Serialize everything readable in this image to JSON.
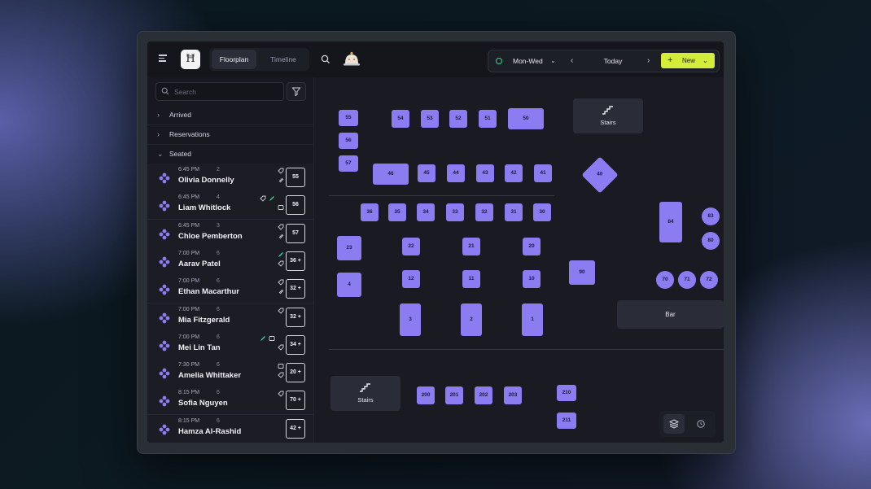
{
  "app": {
    "logo_text": "Ħ",
    "tabs": [
      "Floorplan",
      "Timeline"
    ],
    "active_tab": "Floorplan"
  },
  "toolbar": {
    "day_range": "Mon-Wed",
    "date_label": "Today",
    "new_label": "New"
  },
  "sidebar": {
    "search_placeholder": "Search",
    "sections": [
      {
        "label": "Arrived",
        "expanded": false
      },
      {
        "label": "Reservations",
        "expanded": false
      },
      {
        "label": "Seated",
        "expanded": true
      }
    ],
    "reservations": [
      {
        "time": "6:45 PM",
        "party": "2",
        "name": "Olivia Donnelly",
        "table": "55"
      },
      {
        "time": "6:45 PM",
        "party": "4",
        "name": "Liam Whitlock",
        "table": "56"
      },
      {
        "time": "6:45 PM",
        "party": "3",
        "name": "Chloe Pemberton",
        "table": "57"
      },
      {
        "time": "7:00 PM",
        "party": "6",
        "name": "Aarav Patel",
        "table": "36 +"
      },
      {
        "time": "7:00 PM",
        "party": "6",
        "name": "Ethan Macarthur",
        "table": "32 +"
      },
      {
        "time": "7:00 PM",
        "party": "6",
        "name": "Mia Fitzgerald",
        "table": "32 +"
      },
      {
        "time": "7:00 PM",
        "party": "6",
        "name": "Mei Lin Tan",
        "table": "34 +"
      },
      {
        "time": "7:30 PM",
        "party": "6",
        "name": "Amelia Whittaker",
        "table": "20 +"
      },
      {
        "time": "8:15 PM",
        "party": "6",
        "name": "Sofia Nguyen",
        "table": "70 +"
      },
      {
        "time": "8:15 PM",
        "party": "6",
        "name": "Hamza Al-Rashid",
        "table": "42 +"
      }
    ]
  },
  "floorplan": {
    "stairs_label": "Stairs",
    "bar_label": "Bar",
    "tables": [
      "55",
      "56",
      "57",
      "54",
      "53",
      "52",
      "51",
      "50",
      "46",
      "45",
      "44",
      "43",
      "42",
      "41",
      "40",
      "36",
      "35",
      "34",
      "33",
      "32",
      "31",
      "30",
      "84",
      "83",
      "80",
      "23",
      "22",
      "21",
      "20",
      "90",
      "4",
      "12",
      "11",
      "10",
      "70",
      "71",
      "72",
      "3",
      "2",
      "1",
      "200",
      "201",
      "202",
      "203",
      "210",
      "211"
    ]
  },
  "colors": {
    "accent": "#8b7cf2",
    "new_button": "#d4ec3a",
    "status_green": "#3ecf8e"
  }
}
